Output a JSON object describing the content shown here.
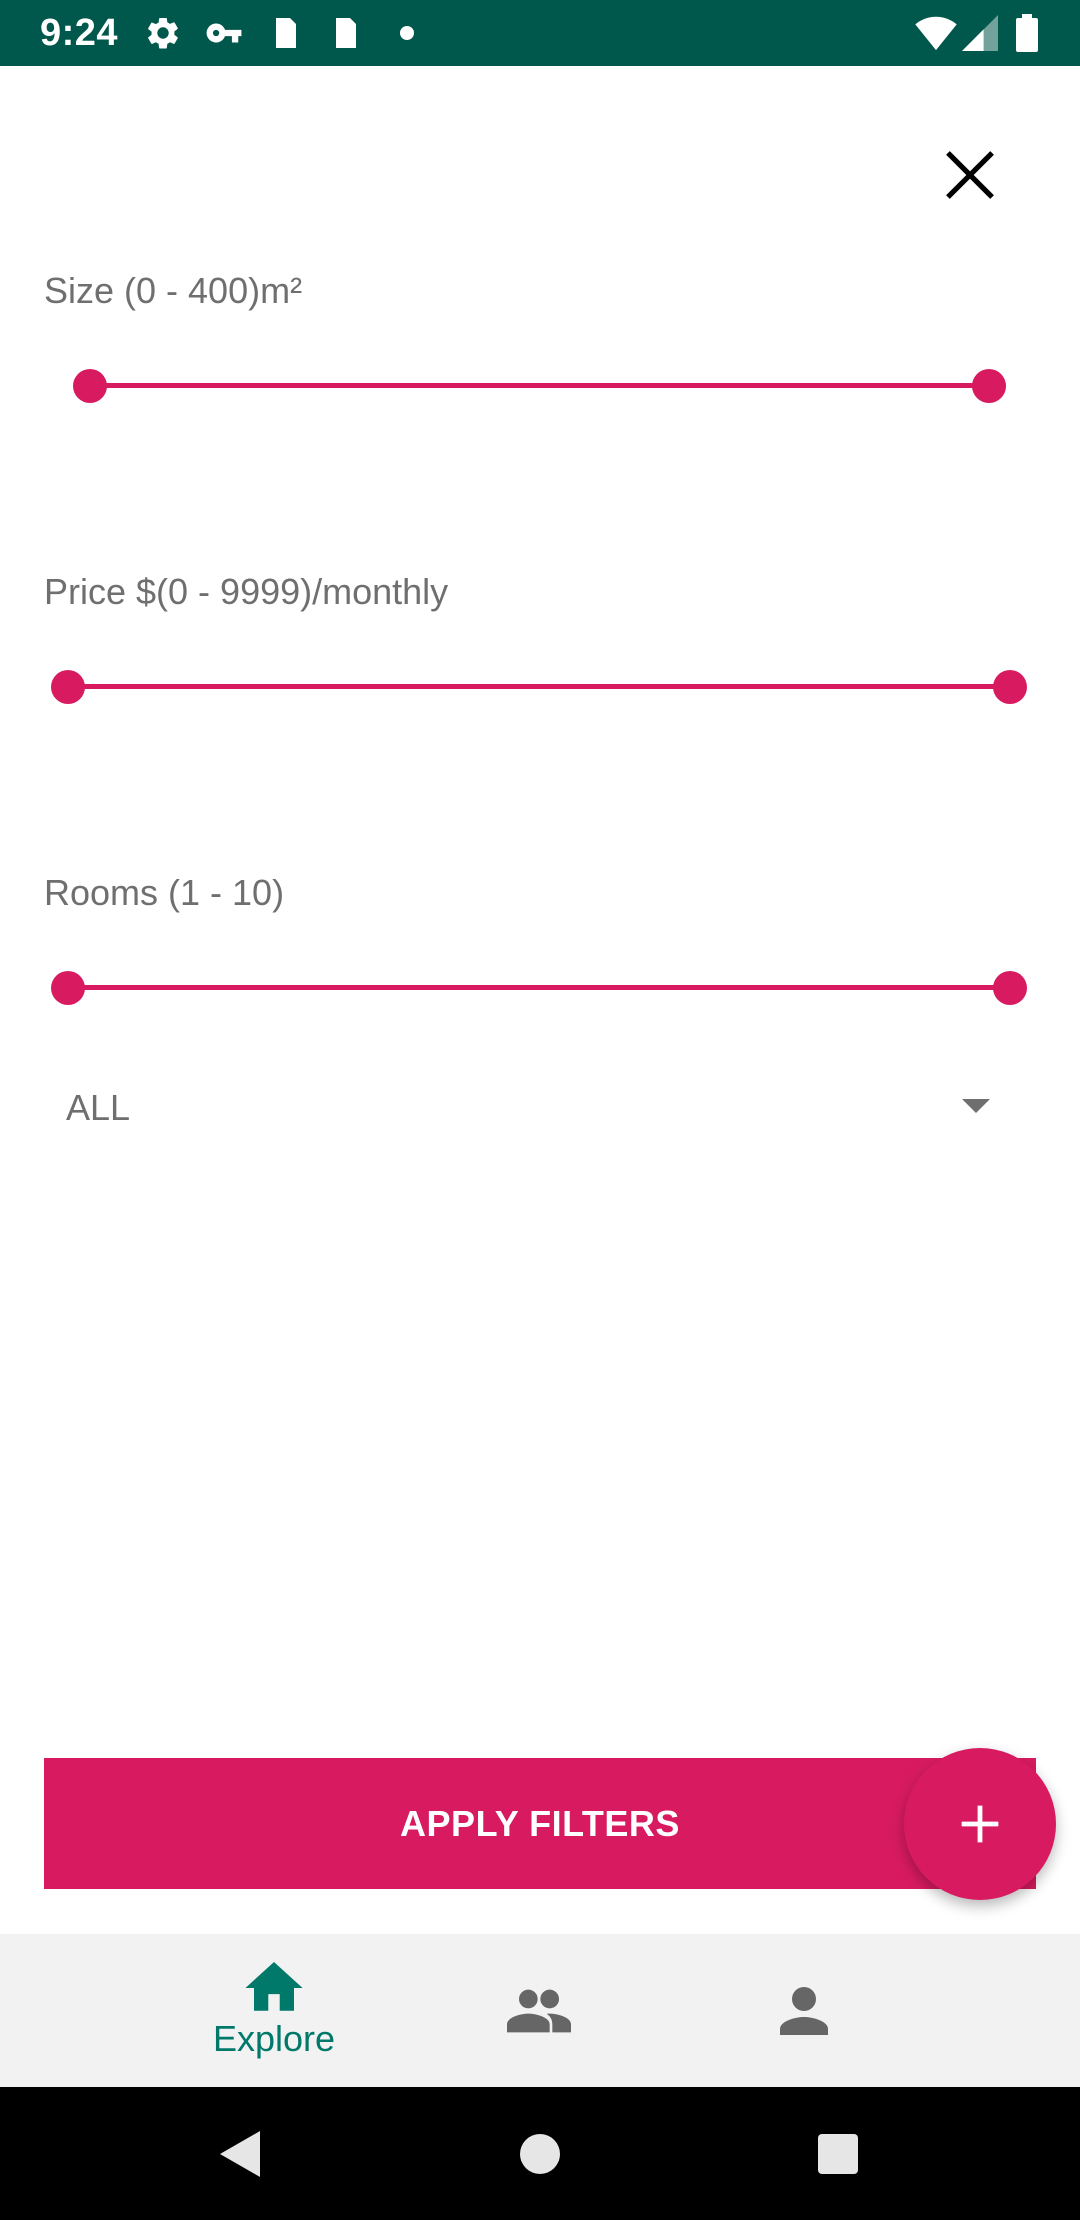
{
  "status_bar": {
    "time": "9:24",
    "icons": [
      "gear-icon",
      "key-icon",
      "sim-card-icon",
      "sim-card-icon",
      "notification-dot-icon",
      "wifi-icon",
      "signal-icon",
      "battery-icon"
    ],
    "background": "#00574B"
  },
  "filters": {
    "size": {
      "label": "Size (0 - 400)m²",
      "min": 0,
      "max": 400,
      "low": 0,
      "high": 400
    },
    "price": {
      "label": "Price $(0 - 9999)/monthly",
      "min": 0,
      "max": 9999,
      "low": 0,
      "high": 9999
    },
    "rooms": {
      "label": "Rooms (1 - 10)",
      "min": 1,
      "max": 10,
      "low": 1,
      "high": 10
    },
    "type_dropdown": {
      "selected": "ALL"
    }
  },
  "apply_button": {
    "label": "APPLY FILTERS"
  },
  "fab": {
    "icon": "plus-icon"
  },
  "bottom_nav": {
    "items": [
      {
        "label": "Explore",
        "icon": "home-icon",
        "active": true
      },
      {
        "label": "",
        "icon": "group-icon",
        "active": false
      },
      {
        "label": "",
        "icon": "person-icon",
        "active": false
      }
    ]
  },
  "system_nav": {
    "icons": [
      "back-icon",
      "home-circle-icon",
      "recents-icon"
    ]
  },
  "colors": {
    "accent": "#D81B60",
    "nav_active": "#00796B",
    "nav_inactive": "#666666",
    "status_bar": "#00574B"
  }
}
